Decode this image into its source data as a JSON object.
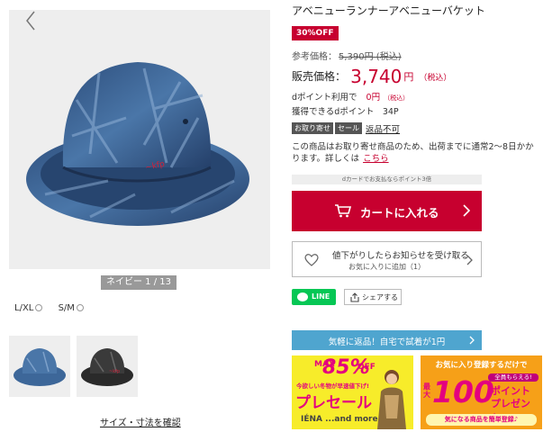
{
  "colors": {
    "accent_red": "#c7002f",
    "line_green": "#06c755",
    "return_blue": "#4fa5cf",
    "banner_yellow": "#f7ec2a",
    "banner_orange": "#f6a018"
  },
  "gallery": {
    "image": "navy-bucket-hat",
    "prev_icon": "chevron-left-icon",
    "next_icon": "chevron-right-icon",
    "counter": "ネイビー 1 / 13"
  },
  "sizes": [
    {
      "label": "L/XL"
    },
    {
      "label": "S/M"
    }
  ],
  "thumbnails": [
    {
      "image": "navy-bucket-hat-thumbnail"
    },
    {
      "image": "black-bucket-hat-thumbnail"
    }
  ],
  "size_guide_link": "サイズ・寸法を確認",
  "product": {
    "title": "アベニューランナーアベニューバケット",
    "discount_badge": "30%OFF",
    "reference_label": "参考価格：",
    "reference_price": "5,390円 (税込)",
    "sale_label": "販売価格：",
    "sale_price": "3,740",
    "sale_yen": "円",
    "sale_tax": "（税込）",
    "dpoint_use_label": "dポイント利用で",
    "dpoint_use_value": "0円",
    "dpoint_use_tax": "（税込）",
    "dpoint_earn": "獲得できるdポイント　34P",
    "tags": [
      "お取り寄せ",
      "セール"
    ],
    "returns_link": "返品不可",
    "notice": "この商品はお取り寄せ商品のため、出荷までに通常2～8日かかります。詳しくは",
    "notice_link": "こちら",
    "dcard_note": "dカードでお支払ならポイント3倍"
  },
  "actions": {
    "cart_button": "カートに入れる",
    "notify_line1": "値下がりしたらお知らせを受け取る",
    "notify_line2": "お気に入りに追加（1）",
    "line_button": "LINE",
    "share_button": "シェアする",
    "return_banner": "気軽に返品！自宅で試着が1円"
  },
  "banners": {
    "sale": {
      "max": "MAX",
      "percent": "85%",
      "off": "OFF",
      "subtitle": "今欲しい冬物が早速値下げ!",
      "main": "プレセール",
      "brand": "IÉNA ...and more!"
    },
    "points": {
      "top": "お気に入り登録するだけで",
      "max": "最大",
      "number": "100",
      "badge": "全員もらえる!",
      "points_line1": "ポイント",
      "points_line2": "プレゼント!",
      "bottom": "気になる商品を簡単登録♪"
    }
  }
}
